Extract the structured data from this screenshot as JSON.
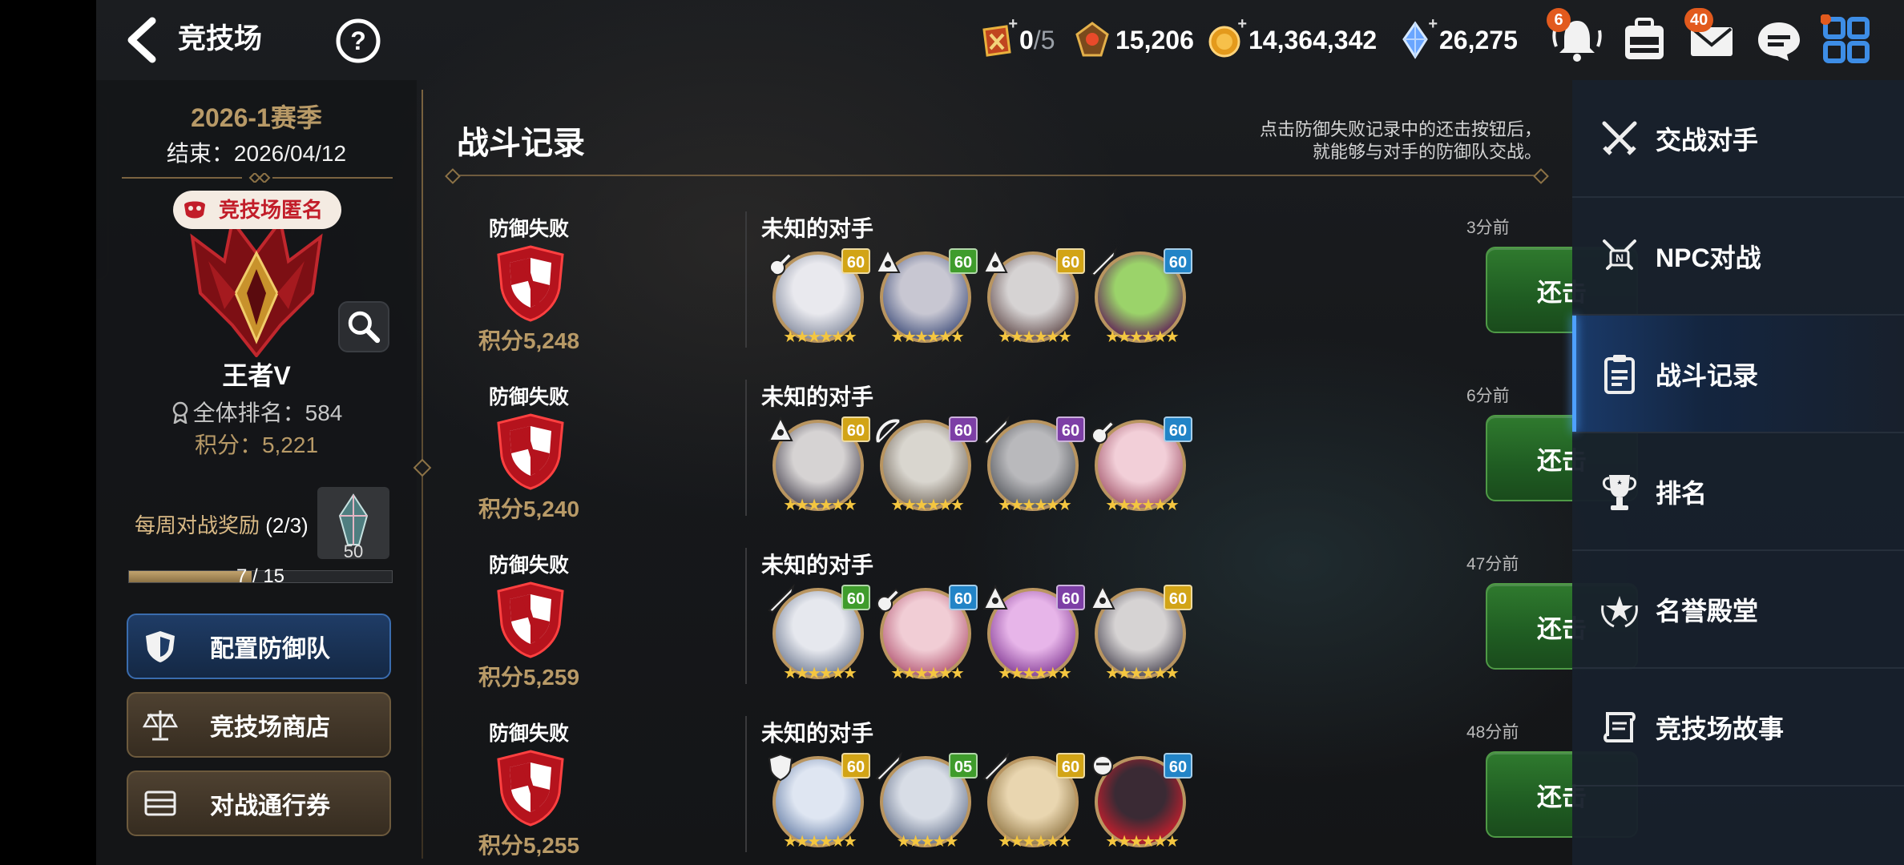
{
  "header": {
    "title": "竞技场",
    "resources": [
      {
        "name": "ticket",
        "value": "0",
        "max": "/5"
      },
      {
        "name": "honor",
        "value": "15,206"
      },
      {
        "name": "gold",
        "value": "14,364,342"
      },
      {
        "name": "crystal",
        "value": "26,275"
      }
    ],
    "notification_badge": "6",
    "mail_badge": "40"
  },
  "left": {
    "season": "2026-1赛季",
    "season_end": "结束：2026/04/12",
    "anonymous_tag": "竞技场匿名",
    "rank_name": "王者V",
    "overall_rank": "全体排名：584",
    "score": "积分：5,221",
    "weekly_label": "每周对战奖励",
    "weekly_count": "(2/3)",
    "reward_count": "50",
    "progress_text": "7 / 15",
    "progress_fraction": 0.4667,
    "buttons": {
      "defense": "配置防御队",
      "shop": "竞技场商店",
      "pass": "对战通行券"
    }
  },
  "records": {
    "title": "战斗记录",
    "hint_line1": "点击防御失败记录中的还击按钮后，",
    "hint_line2": "就能够与对手的防御队交战。",
    "rows": [
      {
        "result": "防御失败",
        "score": "积分5,248",
        "opponent": "未知的对手",
        "time": "3分前",
        "button": "还击",
        "heroes": [
          {
            "level": "60",
            "level_color": "gold",
            "cls": "lute",
            "palette": [
              "#e9e9ee",
              "#9aa0b0"
            ],
            "stars": "★★★★★★"
          },
          {
            "level": "60",
            "level_color": "green",
            "cls": "mage",
            "palette": [
              "#c8c7d2",
              "#5f6a8f"
            ],
            "stars": "★★★★★★"
          },
          {
            "level": "60",
            "level_color": "gold",
            "cls": "mage",
            "palette": [
              "#d6d3d3",
              "#7c6a6a"
            ],
            "stars": "★★★★★★"
          },
          {
            "level": "60",
            "level_color": "blue",
            "cls": "sword",
            "palette": [
              "#9bd36a",
              "#6a3f5a"
            ],
            "stars": "★★★★★★"
          }
        ]
      },
      {
        "result": "防御失败",
        "score": "积分5,240",
        "opponent": "未知的对手",
        "time": "6分前",
        "button": "还击",
        "heroes": [
          {
            "level": "60",
            "level_color": "gold",
            "cls": "mage",
            "palette": [
              "#d6d3d3",
              "#6a6670"
            ],
            "stars": "★★★★★★"
          },
          {
            "level": "60",
            "level_color": "purple",
            "cls": "bow",
            "palette": [
              "#d9d6cf",
              "#8a8176"
            ],
            "stars": "★★★★★★"
          },
          {
            "level": "60",
            "level_color": "purple",
            "cls": "sword",
            "palette": [
              "#b9b9bc",
              "#6b6d72"
            ],
            "stars": "★★★★★★"
          },
          {
            "level": "60",
            "level_color": "blue",
            "cls": "lute",
            "palette": [
              "#f2cfd8",
              "#b36f82"
            ],
            "stars": "★★★★★★"
          }
        ]
      },
      {
        "result": "防御失败",
        "score": "积分5,259",
        "opponent": "未知的对手",
        "time": "47分前",
        "button": "还击",
        "heroes": [
          {
            "level": "60",
            "level_color": "green",
            "cls": "sword",
            "palette": [
              "#e6e8ee",
              "#8a93a6"
            ],
            "stars": "★★★★★★"
          },
          {
            "level": "60",
            "level_color": "blue",
            "cls": "lute",
            "palette": [
              "#f1cdd5",
              "#c07088"
            ],
            "stars": "★★★★★★"
          },
          {
            "level": "60",
            "level_color": "purple",
            "cls": "mage",
            "palette": [
              "#e7b5e9",
              "#9a57a8"
            ],
            "stars": "★★★★★★"
          },
          {
            "level": "60",
            "level_color": "gold",
            "cls": "mage",
            "palette": [
              "#d6d3d3",
              "#6a6670"
            ],
            "stars": "★★★★★★"
          }
        ]
      },
      {
        "result": "防御失败",
        "score": "积分5,255",
        "opponent": "未知的对手",
        "time": "48分前",
        "button": "还击",
        "heroes": [
          {
            "level": "60",
            "level_color": "gold",
            "cls": "shield",
            "palette": [
              "#dfe6f2",
              "#8296b8"
            ],
            "stars": "★★★★★★"
          },
          {
            "level": "05",
            "level_color": "green",
            "cls": "sword",
            "palette": [
              "#d8dde6",
              "#7f8aa0"
            ],
            "stars": "★★★★★"
          },
          {
            "level": "60",
            "level_color": "gold",
            "cls": "sword",
            "palette": [
              "#e9d6b0",
              "#a48b5c"
            ],
            "stars": "★★★★★★"
          },
          {
            "level": "60",
            "level_color": "blue",
            "cls": "rogue",
            "palette": [
              "#3a2a34",
              "#b4202e"
            ],
            "stars": "★★★★★★"
          }
        ]
      }
    ]
  },
  "menu": {
    "items": [
      {
        "label": "交战对手",
        "icon": "crossed-swords-icon"
      },
      {
        "label": "NPC对战",
        "icon": "npc-battle-icon"
      },
      {
        "label": "战斗记录",
        "icon": "clipboard-icon",
        "active": true
      },
      {
        "label": "排名",
        "icon": "trophy-icon"
      },
      {
        "label": "名誉殿堂",
        "icon": "laurel-star-icon"
      },
      {
        "label": "竞技场故事",
        "icon": "scroll-icon"
      }
    ]
  },
  "colors": {
    "accent_gold": "#b89a67",
    "counter_green": "#2f7a2e",
    "menu_active": "#1a3a6a",
    "badge_orange": "#e25a1d"
  }
}
